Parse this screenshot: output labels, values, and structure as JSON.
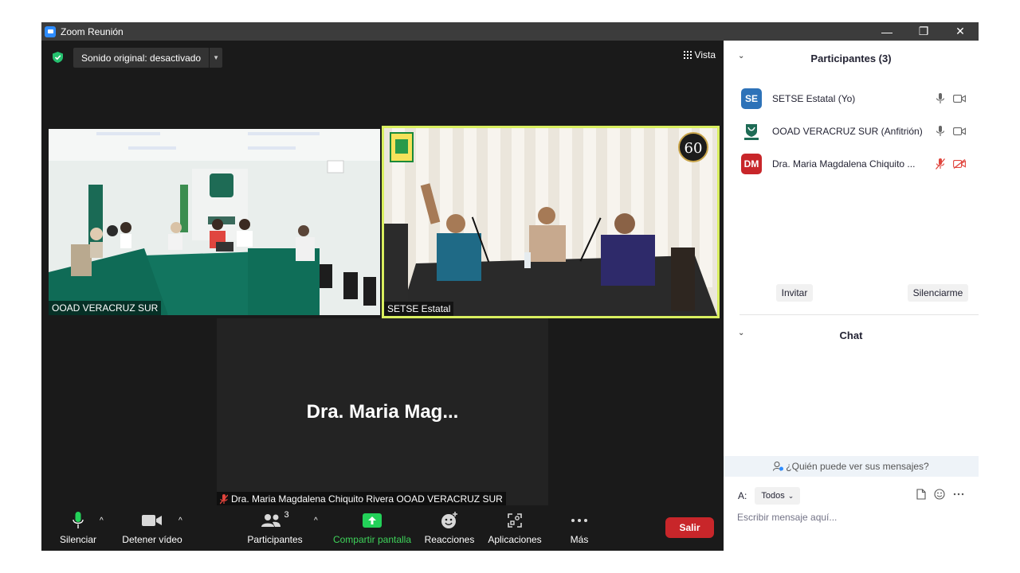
{
  "window": {
    "title": "Zoom Reunión",
    "controls": {
      "minimize": "—",
      "restore": "❐",
      "close": "✕"
    }
  },
  "meeting": {
    "sound_label": "Sonido original: desactivado",
    "view_label": "Vista"
  },
  "videos": [
    {
      "name": "OOAD VERACRUZ SUR"
    },
    {
      "name": "SETSE Estatal",
      "badge": "60"
    },
    {
      "name": "Dra. Maria Magdalena Chiquito Rivera OOAD VERACRUZ SUR",
      "display_name": "Dra. Maria Mag..."
    }
  ],
  "toolbar": {
    "mute": "Silenciar",
    "stop_video": "Detener vídeo",
    "participants": "Participantes",
    "participants_count": "3",
    "share": "Compartir pantalla",
    "reactions": "Reacciones",
    "apps": "Aplicaciones",
    "more": "Más",
    "leave": "Salir"
  },
  "participants_panel": {
    "title": "Participantes (3)",
    "items": [
      {
        "initials": "SE",
        "name": "SETSE Estatal (Yo)",
        "color": "#2d72b8",
        "muted": false
      },
      {
        "initials": "",
        "name": "OOAD VERACRUZ SUR (Anfitrión)",
        "color": "#ffffff",
        "muted": false
      },
      {
        "initials": "DM",
        "name": "Dra. Maria Magdalena Chiquito ...",
        "color": "#c8262a",
        "muted": true
      }
    ],
    "invite": "Invitar",
    "mute_me": "Silenciarme"
  },
  "chat_panel": {
    "title": "Chat",
    "who_can_see": "¿Quién puede ver sus mensajes?",
    "to_label": "A:",
    "to_value": "Todos",
    "placeholder": "Escribir mensaje aquí..."
  },
  "colors": {
    "accent": "#2d8cff",
    "share_green": "#3ed35a",
    "leave_red": "#c8262a",
    "active_speaker": "#d9ef5f"
  }
}
